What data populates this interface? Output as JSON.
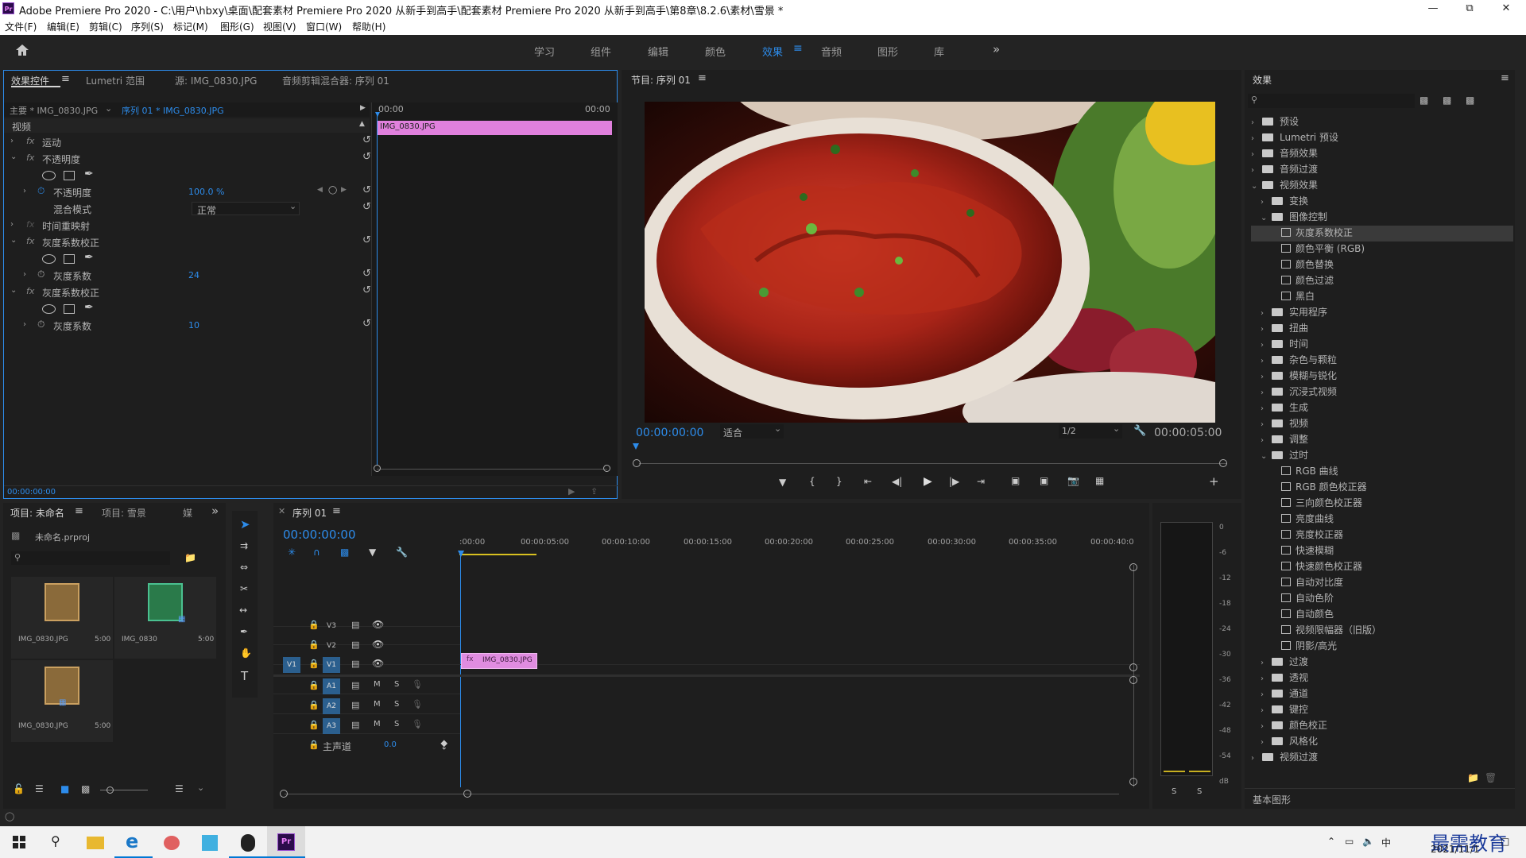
{
  "window": {
    "title": "Adobe Premiere Pro 2020 - C:\\用户\\hbxy\\桌面\\配套素材 Premiere Pro 2020 从新手到高手\\配套素材 Premiere Pro 2020 从新手到高手\\第8章\\8.2.6\\素材\\雪景 *",
    "logo": "Pr"
  },
  "menu": [
    "文件(F)",
    "编辑(E)",
    "剪辑(C)",
    "序列(S)",
    "标记(M)",
    "图形(G)",
    "视图(V)",
    "窗口(W)",
    "帮助(H)"
  ],
  "workspaces": [
    "学习",
    "组件",
    "编辑",
    "颜色",
    "效果",
    "音频",
    "图形",
    "库"
  ],
  "workspace_active": "效果",
  "effect_controls": {
    "tabs": [
      "效果控件",
      "Lumetri 范围",
      "源: IMG_0830.JPG",
      "音频剪辑混合器: 序列 01"
    ],
    "master": "主要 * IMG_0830.JPG",
    "sequence": "序列 01 * IMG_0830.JPG",
    "time_start": "00:00",
    "time_end": "00:00",
    "clip": "IMG_0830.JPG",
    "section": "视频",
    "rows": {
      "motion": "运动",
      "opacity": "不透明度",
      "opacity_param": "不透明度",
      "opacity_val": "100.0 %",
      "blend": "混合模式",
      "blend_val": "正常",
      "remap": "时间重映射",
      "gamma1": "灰度系数校正",
      "gamma1_param": "灰度系数",
      "gamma1_val": "24",
      "gamma2": "灰度系数校正",
      "gamma2_param": "灰度系数",
      "gamma2_val": "10"
    },
    "fx_label": "fx",
    "timecode": "00:00:00:00"
  },
  "program": {
    "title": "节目: 序列 01",
    "timecode": "00:00:00:00",
    "fit": "适合",
    "res": "1/2",
    "duration": "00:00:05:00"
  },
  "effects": {
    "title": "效果",
    "items": [
      {
        "label": "预设",
        "indent": 0,
        "type": "folder",
        "arrow": "›"
      },
      {
        "label": "Lumetri 预设",
        "indent": 0,
        "type": "folder",
        "arrow": "›"
      },
      {
        "label": "音频效果",
        "indent": 0,
        "type": "folder",
        "arrow": "›"
      },
      {
        "label": "音频过渡",
        "indent": 0,
        "type": "folder",
        "arrow": "›"
      },
      {
        "label": "视频效果",
        "indent": 0,
        "type": "folder",
        "arrow": "⌄"
      },
      {
        "label": "变换",
        "indent": 1,
        "type": "folder",
        "arrow": "›"
      },
      {
        "label": "图像控制",
        "indent": 1,
        "type": "folder",
        "arrow": "⌄"
      },
      {
        "label": "灰度系数校正",
        "indent": 2,
        "type": "item",
        "selected": true
      },
      {
        "label": "颜色平衡 (RGB)",
        "indent": 2,
        "type": "item"
      },
      {
        "label": "颜色替换",
        "indent": 2,
        "type": "item"
      },
      {
        "label": "颜色过滤",
        "indent": 2,
        "type": "item"
      },
      {
        "label": "黑白",
        "indent": 2,
        "type": "item"
      },
      {
        "label": "实用程序",
        "indent": 1,
        "type": "folder",
        "arrow": "›"
      },
      {
        "label": "扭曲",
        "indent": 1,
        "type": "folder",
        "arrow": "›"
      },
      {
        "label": "时间",
        "indent": 1,
        "type": "folder",
        "arrow": "›"
      },
      {
        "label": "杂色与颗粒",
        "indent": 1,
        "type": "folder",
        "arrow": "›"
      },
      {
        "label": "模糊与锐化",
        "indent": 1,
        "type": "folder",
        "arrow": "›"
      },
      {
        "label": "沉浸式视频",
        "indent": 1,
        "type": "folder",
        "arrow": "›"
      },
      {
        "label": "生成",
        "indent": 1,
        "type": "folder",
        "arrow": "›"
      },
      {
        "label": "视频",
        "indent": 1,
        "type": "folder",
        "arrow": "›"
      },
      {
        "label": "调整",
        "indent": 1,
        "type": "folder",
        "arrow": "›"
      },
      {
        "label": "过时",
        "indent": 1,
        "type": "folder",
        "arrow": "⌄"
      },
      {
        "label": "RGB 曲线",
        "indent": 2,
        "type": "item"
      },
      {
        "label": "RGB 颜色校正器",
        "indent": 2,
        "type": "item"
      },
      {
        "label": "三向颜色校正器",
        "indent": 2,
        "type": "item"
      },
      {
        "label": "亮度曲线",
        "indent": 2,
        "type": "item"
      },
      {
        "label": "亮度校正器",
        "indent": 2,
        "type": "item"
      },
      {
        "label": "快速模糊",
        "indent": 2,
        "type": "item"
      },
      {
        "label": "快速颜色校正器",
        "indent": 2,
        "type": "item"
      },
      {
        "label": "自动对比度",
        "indent": 2,
        "type": "item"
      },
      {
        "label": "自动色阶",
        "indent": 2,
        "type": "item"
      },
      {
        "label": "自动颜色",
        "indent": 2,
        "type": "item"
      },
      {
        "label": "视频限幅器（旧版）",
        "indent": 2,
        "type": "item"
      },
      {
        "label": "阴影/高光",
        "indent": 2,
        "type": "item"
      },
      {
        "label": "过渡",
        "indent": 1,
        "type": "folder",
        "arrow": "›"
      },
      {
        "label": "透视",
        "indent": 1,
        "type": "folder",
        "arrow": "›"
      },
      {
        "label": "通道",
        "indent": 1,
        "type": "folder",
        "arrow": "›"
      },
      {
        "label": "键控",
        "indent": 1,
        "type": "folder",
        "arrow": "›"
      },
      {
        "label": "颜色校正",
        "indent": 1,
        "type": "folder",
        "arrow": "›"
      },
      {
        "label": "风格化",
        "indent": 1,
        "type": "folder",
        "arrow": "›"
      },
      {
        "label": "视频过渡",
        "indent": 0,
        "type": "folder",
        "arrow": "›"
      }
    ],
    "basic_graphics": "基本图形"
  },
  "project": {
    "tabs": [
      "项目: 未命名",
      "项目: 雪景",
      "媒"
    ],
    "file": "未命名.prproj",
    "items": [
      {
        "name": "IMG_0830.JPG",
        "dur": "5:00"
      },
      {
        "name": "IMG_0830",
        "dur": "5:00"
      },
      {
        "name": "IMG_0830.JPG",
        "dur": "5:00"
      }
    ]
  },
  "timeline": {
    "tab": "序列 01",
    "timecode": "00:00:00:00",
    "ruler": [
      ":00:00",
      "00:00:05:00",
      "00:00:10:00",
      "00:00:15:00",
      "00:00:20:00",
      "00:00:25:00",
      "00:00:30:00",
      "00:00:35:00",
      "00:00:40:0"
    ],
    "video_tracks": [
      "V3",
      "V2",
      "V1"
    ],
    "audio_tracks": [
      "A1",
      "A2",
      "A3"
    ],
    "source_patch": "V1",
    "master": "主声道",
    "master_val": "0.0",
    "clip": "IMG_0830.JPG",
    "mute": "M",
    "solo": "S"
  },
  "meter": {
    "scale": [
      "0",
      "-6",
      "-12",
      "-18",
      "-24",
      "-30",
      "-36",
      "-42",
      "-48",
      "-54",
      "dB"
    ],
    "solo": [
      "S",
      "S"
    ]
  },
  "taskbar": {
    "date": "2021/11/1",
    "watermark": "最需教育",
    "ime": "中"
  },
  "colors": {
    "accent": "#2d8ceb",
    "clip": "#e08ce0",
    "track_on": "#2b5f8e"
  }
}
